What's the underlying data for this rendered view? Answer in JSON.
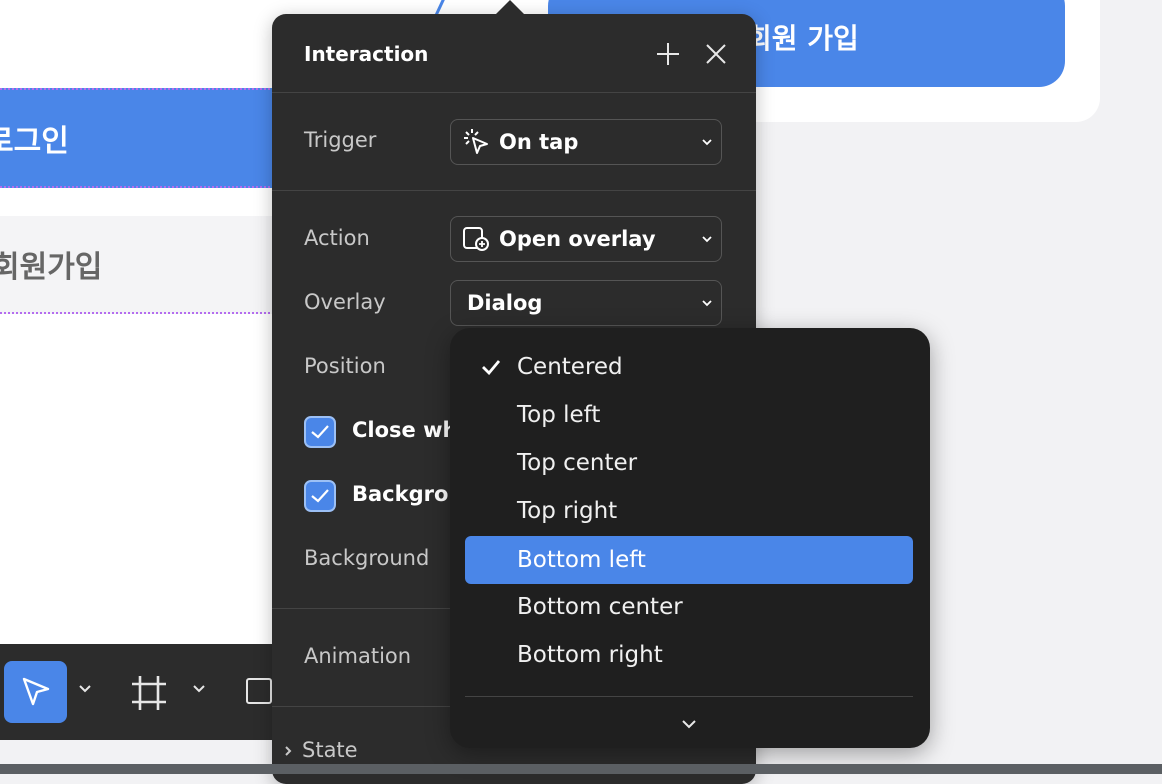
{
  "canvas": {
    "signup_button": "회원 가입",
    "login_button": "로그인",
    "register_link": "회원가입"
  },
  "toolbar": {
    "tools": [
      "move-tool",
      "frame-tool",
      "rectangle-tool"
    ]
  },
  "panel": {
    "title": "Interaction",
    "trigger": {
      "label": "Trigger",
      "value": "On tap"
    },
    "action": {
      "label": "Action",
      "value": "Open overlay"
    },
    "overlay": {
      "label": "Overlay",
      "value": "Dialog"
    },
    "position": {
      "label": "Position"
    },
    "close_when": {
      "label": "Close wh",
      "checked": true
    },
    "background_check": {
      "label": "Backgrou",
      "checked": true
    },
    "background": {
      "label": "Background"
    },
    "animation": {
      "label": "Animation"
    },
    "state": {
      "label": "State"
    }
  },
  "position_menu": {
    "items": [
      {
        "label": "Centered",
        "checked": true,
        "highlighted": false
      },
      {
        "label": "Top left",
        "checked": false,
        "highlighted": false
      },
      {
        "label": "Top center",
        "checked": false,
        "highlighted": false
      },
      {
        "label": "Top right",
        "checked": false,
        "highlighted": false
      },
      {
        "label": "Bottom left",
        "checked": false,
        "highlighted": true
      },
      {
        "label": "Bottom center",
        "checked": false,
        "highlighted": false
      },
      {
        "label": "Bottom right",
        "checked": false,
        "highlighted": false
      }
    ]
  },
  "colors": {
    "accent": "#4a86e8",
    "panel_bg": "#2c2c2c",
    "menu_bg": "#1f1f1f",
    "guide_dotted": "#b46cf0"
  }
}
